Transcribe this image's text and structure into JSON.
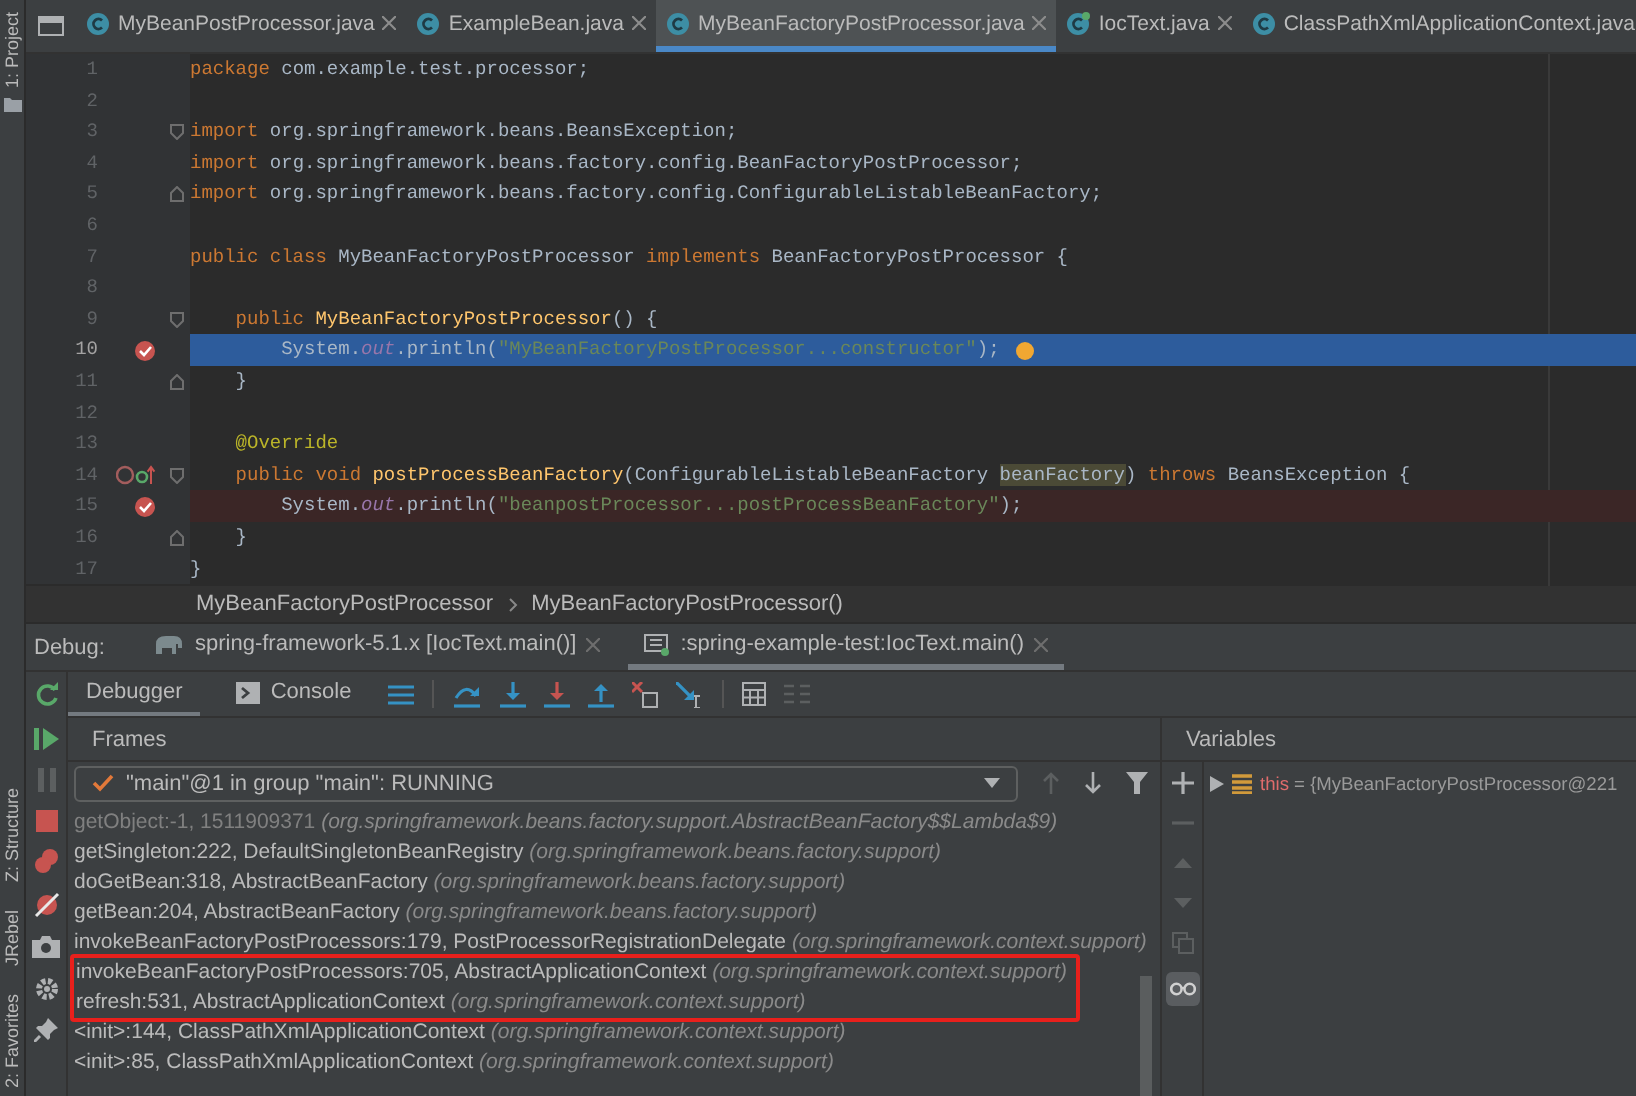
{
  "tool_strip": {
    "top": [
      {
        "label": "1: Project"
      }
    ],
    "bottom": [
      {
        "label": "Z: Structure"
      },
      {
        "label": "JRebel"
      },
      {
        "label": "2: Favorites"
      }
    ]
  },
  "editor_tabs": [
    {
      "label": "MyBeanPostProcessor.java",
      "selected": false,
      "closable": true,
      "kind": "class"
    },
    {
      "label": "ExampleBean.java",
      "selected": false,
      "closable": true,
      "kind": "class"
    },
    {
      "label": "MyBeanFactoryPostProcessor.java",
      "selected": true,
      "closable": true,
      "kind": "class"
    },
    {
      "label": "IocText.java",
      "selected": false,
      "closable": true,
      "kind": "runnable"
    },
    {
      "label": "ClassPathXmlApplicationContext.java",
      "selected": false,
      "closable": false,
      "kind": "class"
    }
  ],
  "code_lines": [
    {
      "number": "1",
      "current": false,
      "breakpoint": false,
      "fold_start": false,
      "fold_end": false,
      "override_marker": false,
      "segments": [
        {
          "kind": "keyword",
          "text": "package"
        },
        {
          "kind": "plain",
          "text": " com.example.test.processor;"
        }
      ]
    },
    {
      "number": "2",
      "current": false,
      "breakpoint": false,
      "fold_start": false,
      "fold_end": false,
      "override_marker": false
    },
    {
      "number": "3",
      "current": false,
      "breakpoint": false,
      "fold_start": true,
      "fold_end": false,
      "override_marker": false,
      "segments": [
        {
          "kind": "keyword",
          "text": "import"
        },
        {
          "kind": "plain",
          "text": " org.springframework.beans.BeansException;"
        }
      ]
    },
    {
      "number": "4",
      "current": false,
      "breakpoint": false,
      "fold_start": false,
      "fold_end": false,
      "override_marker": false,
      "segments": [
        {
          "kind": "keyword",
          "text": "import"
        },
        {
          "kind": "plain",
          "text": " org.springframework.beans.factory.config.BeanFactoryPostProcessor;"
        }
      ]
    },
    {
      "number": "5",
      "current": false,
      "breakpoint": false,
      "fold_start": false,
      "fold_end": true,
      "override_marker": false,
      "segments": [
        {
          "kind": "keyword",
          "text": "import"
        },
        {
          "kind": "plain",
          "text": " org.springframework.beans.factory.config.ConfigurableListableBeanFactory;"
        }
      ]
    },
    {
      "number": "6",
      "current": false,
      "breakpoint": false,
      "fold_start": false,
      "fold_end": false,
      "override_marker": false
    },
    {
      "number": "7",
      "current": false,
      "breakpoint": false,
      "fold_start": false,
      "fold_end": false,
      "override_marker": false,
      "segments": [
        {
          "kind": "keyword",
          "text": "public class "
        },
        {
          "kind": "plain",
          "text": "MyBeanFactoryPostProcessor"
        },
        {
          "kind": "keyword",
          "text": " implements "
        },
        {
          "kind": "plain",
          "text": "BeanFactoryPostProcessor {"
        }
      ]
    },
    {
      "number": "8",
      "current": false,
      "breakpoint": false,
      "fold_start": false,
      "fold_end": false,
      "override_marker": false
    },
    {
      "number": "9",
      "current": false,
      "breakpoint": false,
      "fold_start": true,
      "fold_end": false,
      "override_marker": false,
      "segments": [
        {
          "kind": "keyword",
          "text": "    public "
        },
        {
          "kind": "method",
          "text": "MyBeanFactoryPostProcessor"
        },
        {
          "kind": "plain",
          "text": "() {"
        }
      ]
    },
    {
      "number": "10",
      "current": true,
      "breakpoint": true,
      "fold_start": false,
      "fold_end": false,
      "override_marker": false,
      "segments": [
        {
          "kind": "plain",
          "text": "        System."
        },
        {
          "kind": "field",
          "text": "out"
        },
        {
          "kind": "plain",
          "text": ".println("
        },
        {
          "kind": "string",
          "text": "\"MyBeanFactoryPostProcessor...constructor\""
        },
        {
          "kind": "plain",
          "text": ");"
        }
      ]
    },
    {
      "number": "11",
      "current": false,
      "breakpoint": false,
      "fold_start": false,
      "fold_end": true,
      "override_marker": false,
      "segments": [
        {
          "kind": "plain",
          "text": "    }"
        }
      ]
    },
    {
      "number": "12",
      "current": false,
      "breakpoint": false,
      "fold_start": false,
      "fold_end": false,
      "override_marker": false
    },
    {
      "number": "13",
      "current": false,
      "breakpoint": false,
      "fold_start": false,
      "fold_end": false,
      "override_marker": false,
      "segments": [
        {
          "kind": "annotation",
          "text": "    @Override"
        }
      ]
    },
    {
      "number": "14",
      "current": false,
      "breakpoint": false,
      "fold_start": true,
      "fold_end": false,
      "override_marker": true,
      "segments": [
        {
          "kind": "keyword",
          "text": "    public void "
        },
        {
          "kind": "method",
          "text": "postProcessBeanFactory"
        },
        {
          "kind": "plain",
          "text": "(ConfigurableListableBeanFactory "
        },
        {
          "kind": "param",
          "text": "beanFactory"
        },
        {
          "kind": "plain",
          "text": ") "
        },
        {
          "kind": "keyword",
          "text": "throws "
        },
        {
          "kind": "plain",
          "text": "BeansException {"
        }
      ]
    },
    {
      "number": "15",
      "current": false,
      "breakpoint": true,
      "fold_start": false,
      "fold_end": false,
      "override_marker": false,
      "segments": [
        {
          "kind": "plain",
          "text": "        System."
        },
        {
          "kind": "field",
          "text": "out"
        },
        {
          "kind": "plain",
          "text": ".println("
        },
        {
          "kind": "string",
          "text": "\"beanpostProcessor...postProcessBeanFactory\""
        },
        {
          "kind": "plain",
          "text": ");"
        }
      ]
    },
    {
      "number": "16",
      "current": false,
      "breakpoint": false,
      "fold_start": false,
      "fold_end": true,
      "override_marker": false,
      "segments": [
        {
          "kind": "plain",
          "text": "    }"
        }
      ]
    },
    {
      "number": "17",
      "current": false,
      "breakpoint": false,
      "fold_start": false,
      "fold_end": false,
      "override_marker": false,
      "segments": [
        {
          "kind": "plain",
          "text": "}"
        }
      ]
    }
  ],
  "breadcrumb": [
    "MyBeanFactoryPostProcessor",
    "MyBeanFactoryPostProcessor()"
  ],
  "debug": {
    "label": "Debug:",
    "sessions": [
      {
        "label": "spring-framework-5.1.x [IocText.main()]",
        "selected": false
      },
      {
        "label": ":spring-example-test:IocText.main()",
        "selected": true
      }
    ],
    "panel_tabs": [
      {
        "label": "Debugger",
        "selected": true,
        "kind": "debugger"
      },
      {
        "label": "Console",
        "selected": false,
        "kind": "console"
      }
    ],
    "frames": {
      "title": "Frames",
      "thread": "\"main\"@1 in group \"main\": RUNNING",
      "items": [
        {
          "method": "getObject:-1, 1511909371",
          "package": "(org.springframework.beans.factory.support.AbstractBeanFactory$$Lambda$9)",
          "dim": true,
          "boxed": false
        },
        {
          "method": "getSingleton:222, DefaultSingletonBeanRegistry",
          "package": "(org.springframework.beans.factory.support)",
          "dim": false,
          "boxed": false
        },
        {
          "method": "doGetBean:318, AbstractBeanFactory",
          "package": "(org.springframework.beans.factory.support)",
          "dim": false,
          "boxed": false
        },
        {
          "method": "getBean:204, AbstractBeanFactory",
          "package": "(org.springframework.beans.factory.support)",
          "dim": false,
          "boxed": false
        },
        {
          "method": "invokeBeanFactoryPostProcessors:179, PostProcessorRegistrationDelegate",
          "package": "(org.springframework.context.support)",
          "dim": false,
          "boxed": false
        },
        {
          "method": "invokeBeanFactoryPostProcessors:705, AbstractApplicationContext",
          "package": "(org.springframework.context.support)",
          "dim": false,
          "boxed": true
        },
        {
          "method": "refresh:531, AbstractApplicationContext",
          "package": "(org.springframework.context.support)",
          "dim": false,
          "boxed": true
        },
        {
          "method": "<init>:144, ClassPathXmlApplicationContext",
          "package": "(org.springframework.context.support)",
          "dim": false,
          "boxed": false
        },
        {
          "method": "<init>:85, ClassPathXmlApplicationContext",
          "package": "(org.springframework.context.support)",
          "dim": false,
          "boxed": false
        }
      ]
    },
    "variables": {
      "title": "Variables",
      "items": [
        {
          "name": "this",
          "value": " = {MyBeanFactoryPostProcessor@221",
          "expanded": false
        }
      ]
    }
  }
}
